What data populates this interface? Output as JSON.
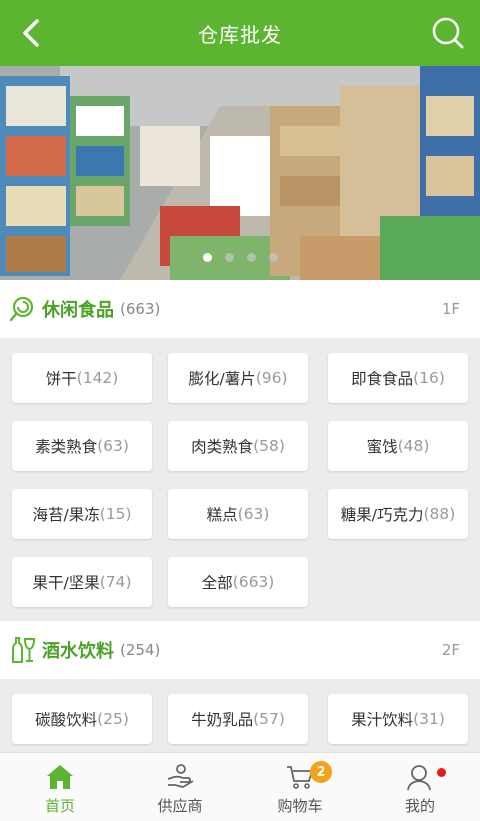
{
  "header": {
    "title": "仓库批发",
    "back_icon": "chevron-left-icon",
    "search_icon": "search-icon"
  },
  "banner": {
    "slides": 4,
    "active_slide": 1
  },
  "sections": [
    {
      "name": "休闲食品",
      "count": "(663)",
      "floor": "1F",
      "icon": "snack-icon",
      "items": [
        {
          "label": "饼干",
          "count": "(142)"
        },
        {
          "label": "膨化/薯片",
          "count": "(96)"
        },
        {
          "label": "即食食品",
          "count": "(16)"
        },
        {
          "label": "素类熟食",
          "count": "(63)"
        },
        {
          "label": "肉类熟食",
          "count": "(58)"
        },
        {
          "label": "蜜饯",
          "count": "(48)"
        },
        {
          "label": "海苔/果冻",
          "count": "(15)"
        },
        {
          "label": "糕点",
          "count": "(63)"
        },
        {
          "label": "糖果/巧克力",
          "count": "(88)"
        },
        {
          "label": "果干/坚果",
          "count": "(74)"
        },
        {
          "label": "全部",
          "count": "(663)"
        }
      ]
    },
    {
      "name": "酒水饮料",
      "count": "(254)",
      "floor": "2F",
      "icon": "drinks-icon",
      "items": [
        {
          "label": "碳酸饮料",
          "count": "(25)"
        },
        {
          "label": "牛奶乳品",
          "count": "(57)"
        },
        {
          "label": "果汁饮料",
          "count": "(31)"
        }
      ]
    }
  ],
  "tabbar": {
    "tabs": [
      {
        "label": "首页",
        "icon": "home-icon",
        "active": true
      },
      {
        "label": "供应商",
        "icon": "supplier-icon"
      },
      {
        "label": "购物车",
        "icon": "cart-icon",
        "badge": "2"
      },
      {
        "label": "我的",
        "icon": "user-icon",
        "dot": true
      }
    ]
  },
  "colors": {
    "brand": "#5cb531",
    "badge": "#f5a21b",
    "alert": "#e21b1b"
  }
}
